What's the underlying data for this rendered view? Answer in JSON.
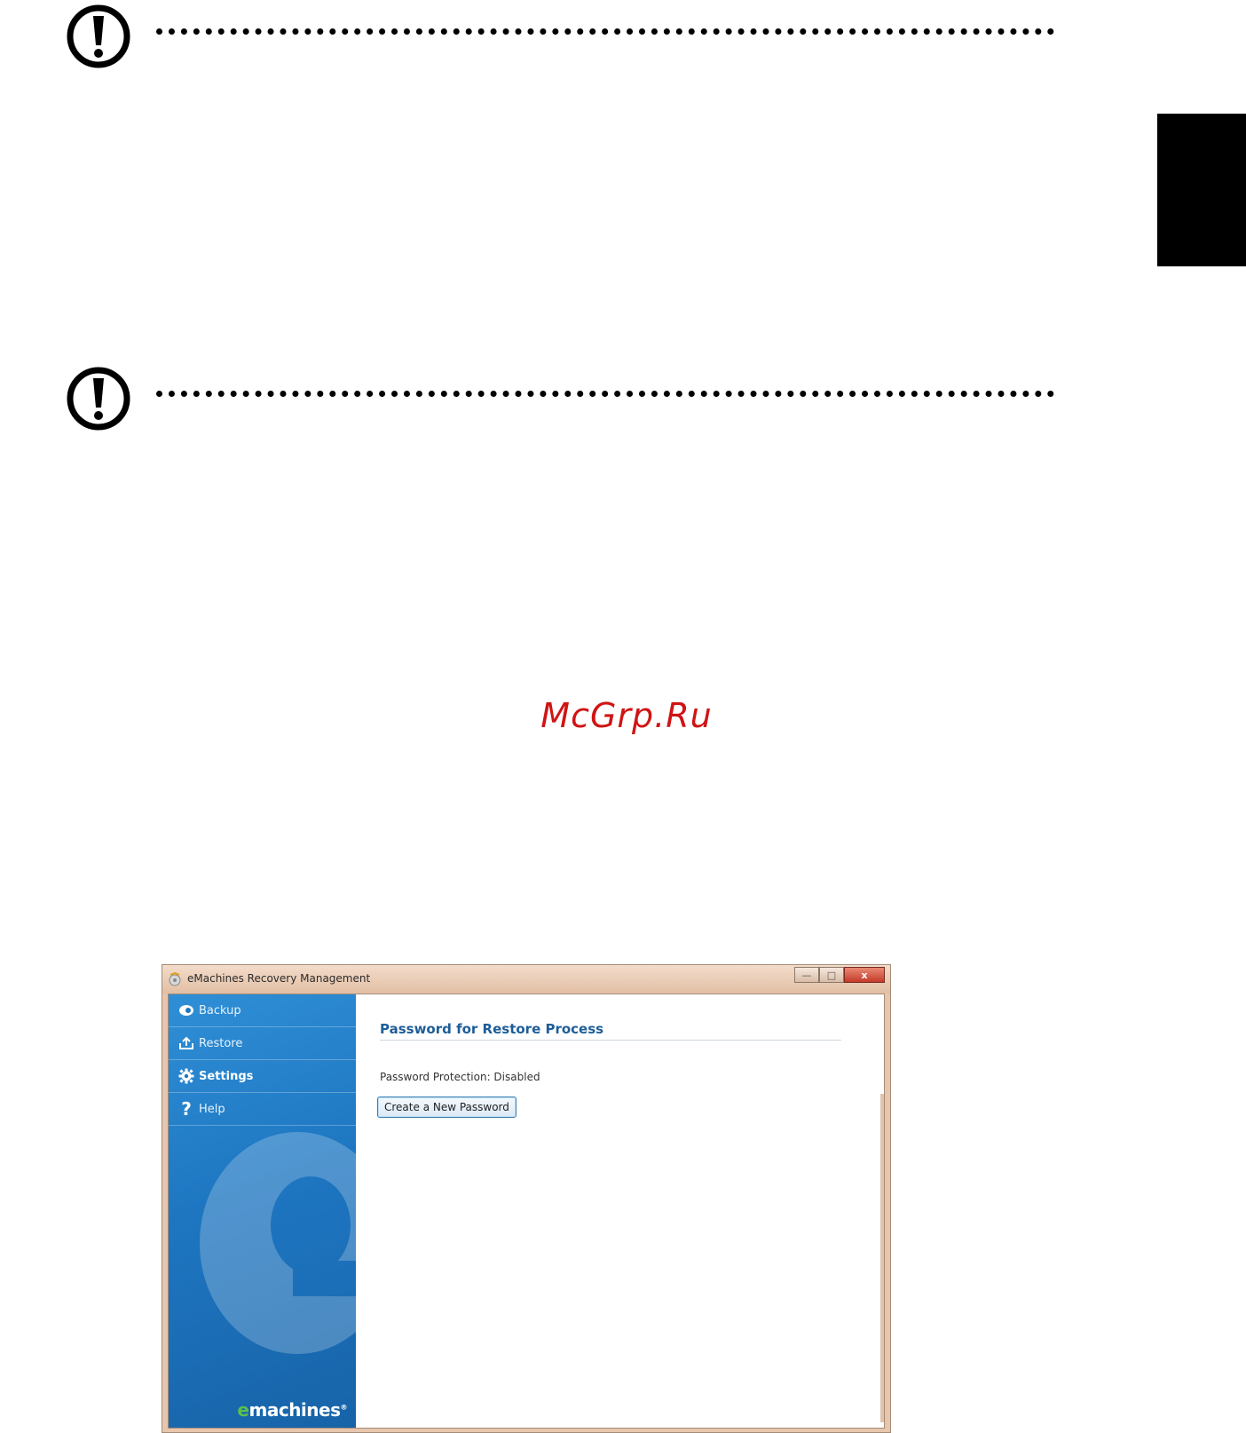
{
  "window": {
    "title": "eMachines Recovery Management",
    "controls": {
      "minimize": "—",
      "maximize": "□",
      "close": "x"
    }
  },
  "sidebar": {
    "items": [
      {
        "label": "Backup",
        "icon": "backup-icon",
        "active": false
      },
      {
        "label": "Restore",
        "icon": "restore-icon",
        "active": false
      },
      {
        "label": "Settings",
        "icon": "gear-icon",
        "active": true
      },
      {
        "label": "Help",
        "icon": "help-icon",
        "glyph": "?",
        "active": false
      }
    ],
    "brand": {
      "e": "e",
      "name": "machines",
      "mark": "®"
    }
  },
  "main": {
    "section_title": "Password for Restore Process",
    "status": "Password Protection: Disabled",
    "button_label": "Create a New Password"
  },
  "watermark": "McGrp.Ru",
  "colors": {
    "sidebar_blue": "#1e76c1",
    "title_blue": "#1d5d98",
    "watermark_red": "#d01414",
    "window_frame": "#e7c6ad",
    "brand_green": "#5cc04a"
  }
}
